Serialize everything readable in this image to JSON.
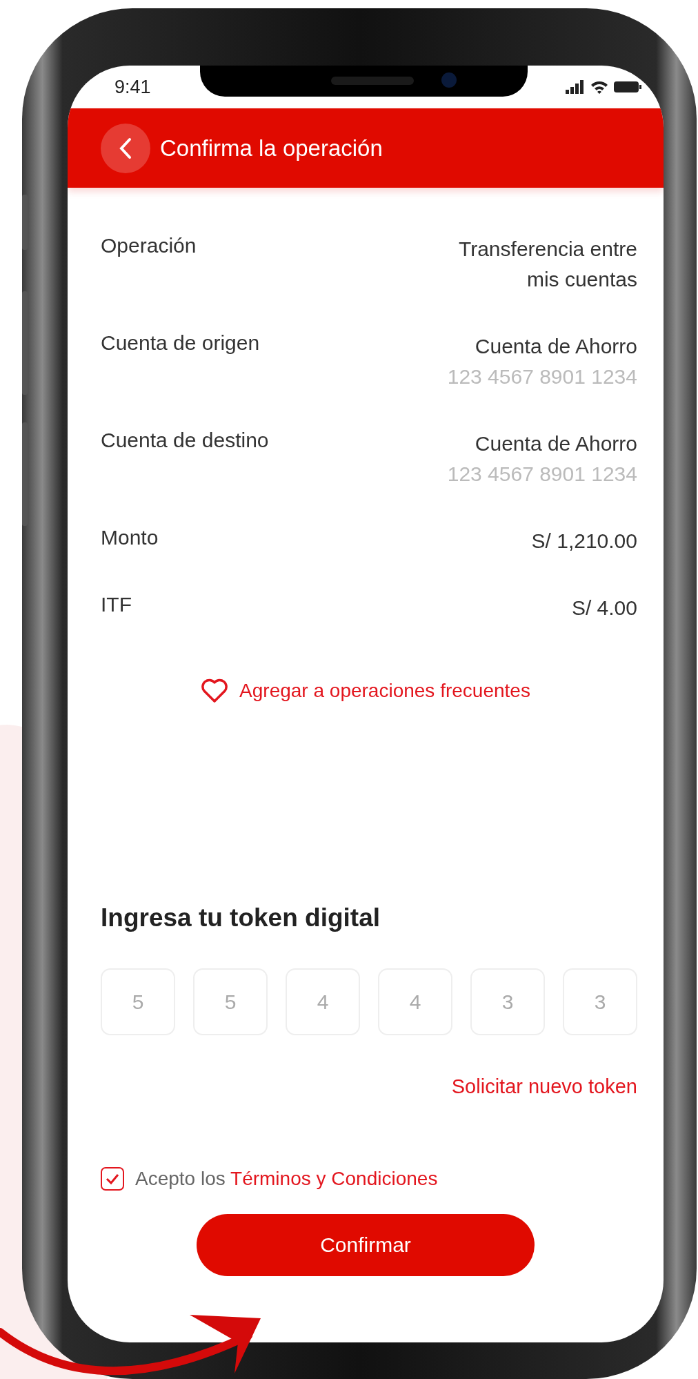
{
  "status_bar": {
    "time": "9:41"
  },
  "header": {
    "title": "Confirma la operación"
  },
  "details": [
    {
      "label": "Operación",
      "value": "Transferencia entre mis cuentas"
    },
    {
      "label": "Cuenta de origen",
      "value": "Cuenta de Ahorro",
      "sub": "123 4567 8901 1234"
    },
    {
      "label": "Cuenta de destino",
      "value": "Cuenta de Ahorro",
      "sub": "123 4567 8901 1234"
    },
    {
      "label": "Monto",
      "value": "S/ 1,210.00"
    },
    {
      "label": "ITF",
      "value": "S/ 4.00"
    }
  ],
  "favorite_link": "Agregar a operaciones frecuentes",
  "token": {
    "title": "Ingresa tu token digital",
    "digits": [
      "5",
      "5",
      "4",
      "4",
      "3",
      "3"
    ],
    "resend_link": "Solicitar nuevo token"
  },
  "terms": {
    "checked": true,
    "prefix": "Acepto los",
    "link": "Términos y Condiciones"
  },
  "confirm_button": "Confirmar"
}
